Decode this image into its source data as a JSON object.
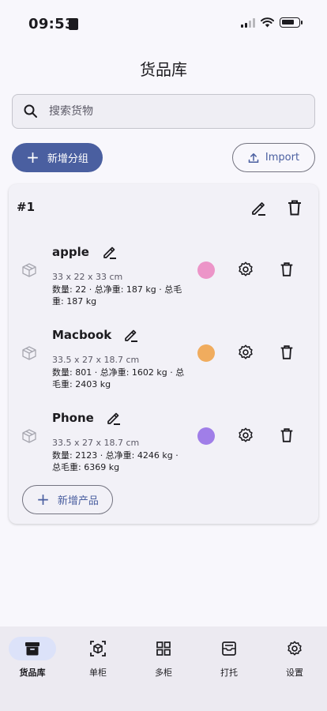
{
  "status_bar": {
    "time": "09:53"
  },
  "page": {
    "title": "货品库"
  },
  "search": {
    "placeholder": "搜索货物"
  },
  "actions": {
    "add_group_label": "新增分组",
    "import_label": "Import"
  },
  "group": {
    "title": "#1",
    "add_product_label": "新增产品",
    "products": [
      {
        "name": "apple",
        "dims": "33 x 22 x 33 cm",
        "stats": "数量: 22  ·  总净重: 187 kg  ·  总毛重: 187 kg",
        "color": "#ec95c8"
      },
      {
        "name": "Macbook",
        "dims": "33.5 x 27 x 18.7 cm",
        "stats": "数量: 801  ·  总净重: 1602 kg  ·  总毛重: 2403 kg",
        "color": "#f0ac5e"
      },
      {
        "name": "Phone",
        "dims": "33.5 x 27 x 18.7 cm",
        "stats": "数量: 2123  ·  总净重: 4246 kg  ·  总毛重: 6369 kg",
        "color": "#a07ee8"
      }
    ]
  },
  "nav": {
    "items": [
      {
        "label": "货品库",
        "icon": "archive-icon",
        "active": true
      },
      {
        "label": "单柜",
        "icon": "box-scan-icon",
        "active": false
      },
      {
        "label": "多柜",
        "icon": "grid-icon",
        "active": false
      },
      {
        "label": "打托",
        "icon": "pallet-icon",
        "active": false
      },
      {
        "label": "设置",
        "icon": "gear-icon",
        "active": false
      }
    ]
  },
  "colors": {
    "primary": "#4a5fa0",
    "background": "#f8f7fc",
    "nav_active": "#dce2f9"
  }
}
